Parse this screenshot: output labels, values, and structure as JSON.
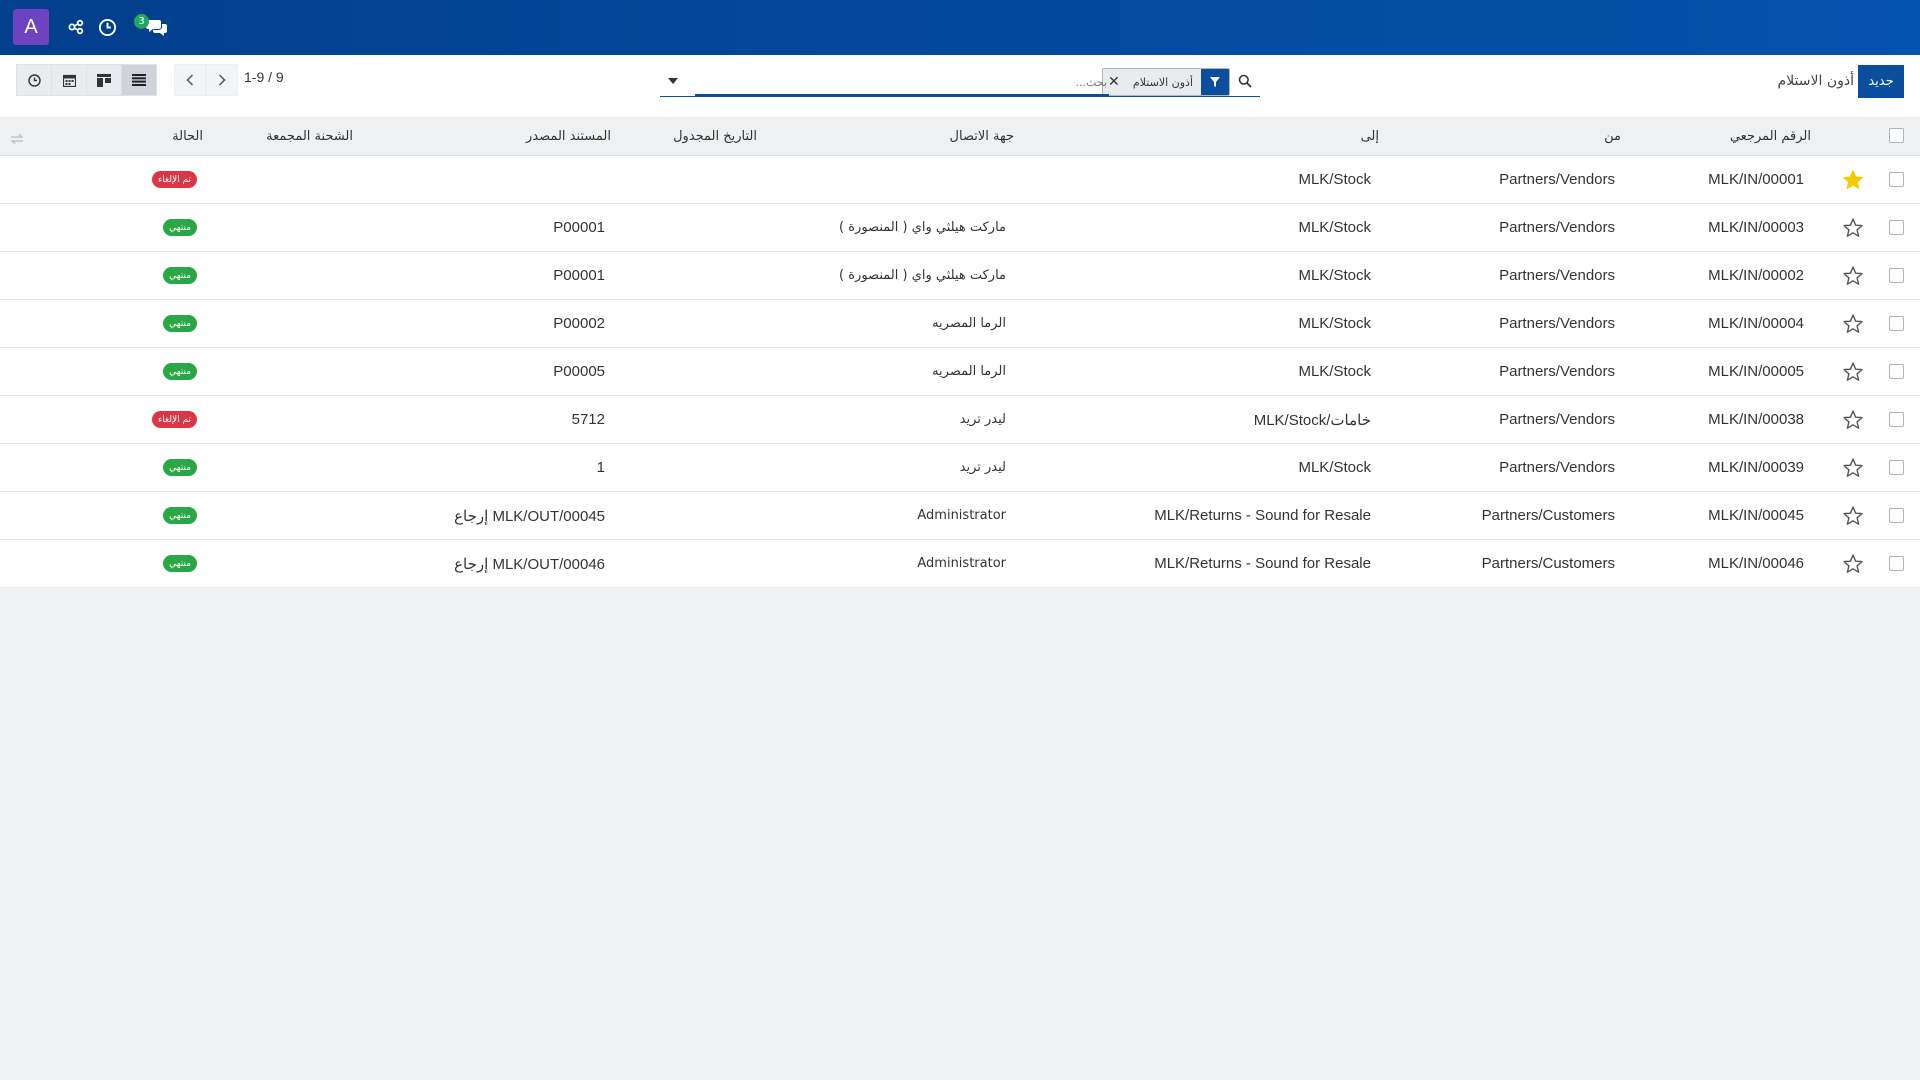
{
  "navbar": {
    "avatar_letter": "A",
    "icons": [
      "share-nodes-icon",
      "clock-icon",
      "chat-icon"
    ],
    "messages_count": "3",
    "brand_color": "#0453ac"
  },
  "control_panel": {
    "new_button": "جديد",
    "breadcrumb": "أذون الاستلام",
    "search": {
      "facet_label": "أذون الاستلام",
      "placeholder": "بحث..."
    },
    "pager": "1-9 / 9"
  },
  "table": {
    "headers": {
      "reference": "الرقم المرجعي",
      "from": "من",
      "to": "إلى",
      "contact": "جهة الاتصال",
      "scheduled_date": "التاريخ المجدول",
      "source_document": "المستند المصدر",
      "batch": "الشحنة المجمعة",
      "status": "الحالة"
    },
    "rows": [
      {
        "reference": "MLK/IN/00001",
        "from": "Partners/Vendors",
        "to": "MLK/Stock",
        "contact": "",
        "source": "",
        "status": "تم الإلغاء",
        "status_color": "red",
        "starred": true
      },
      {
        "reference": "MLK/IN/00003",
        "from": "Partners/Vendors",
        "to": "MLK/Stock",
        "contact": "ماركت هيلثي واي ( المنصورة )",
        "source": "P00001",
        "status": "منتهي",
        "status_color": "green",
        "starred": false
      },
      {
        "reference": "MLK/IN/00002",
        "from": "Partners/Vendors",
        "to": "MLK/Stock",
        "contact": "ماركت هيلثي واي ( المنصورة )",
        "source": "P00001",
        "status": "منتهي",
        "status_color": "green",
        "starred": false
      },
      {
        "reference": "MLK/IN/00004",
        "from": "Partners/Vendors",
        "to": "MLK/Stock",
        "contact": "الرما المصريه",
        "source": "P00002",
        "status": "منتهي",
        "status_color": "green",
        "starred": false
      },
      {
        "reference": "MLK/IN/00005",
        "from": "Partners/Vendors",
        "to": "MLK/Stock",
        "contact": "الرما المصريه",
        "source": "P00005",
        "status": "منتهي",
        "status_color": "green",
        "starred": false
      },
      {
        "reference": "MLK/IN/00038",
        "from": "Partners/Vendors",
        "to": "MLK/Stock/خامات",
        "contact": "ليدر تريد",
        "source": "5712",
        "status": "تم الإلغاء",
        "status_color": "red",
        "starred": false
      },
      {
        "reference": "MLK/IN/00039",
        "from": "Partners/Vendors",
        "to": "MLK/Stock",
        "contact": "ليدر تريد",
        "source": "1",
        "status": "منتهي",
        "status_color": "green",
        "starred": false
      },
      {
        "reference": "MLK/IN/00045",
        "from": "Partners/Customers",
        "to": "MLK/Returns - Sound for Resale",
        "contact": "Administrator",
        "source": "إرجاع MLK/OUT/00045",
        "status": "منتهي",
        "status_color": "green",
        "starred": false
      },
      {
        "reference": "MLK/IN/00046",
        "from": "Partners/Customers",
        "to": "MLK/Returns - Sound for Resale",
        "contact": "Administrator",
        "source": "إرجاع MLK/OUT/00046",
        "status": "منتهي",
        "status_color": "green",
        "starred": false
      }
    ]
  }
}
